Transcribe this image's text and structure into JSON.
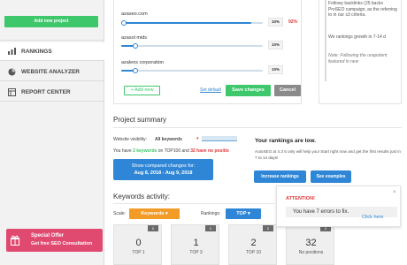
{
  "sidebar": {
    "add_project": "Add new project",
    "nav": [
      {
        "label": "RANKINGS",
        "icon": "rankings-bars-icon"
      },
      {
        "label": "WEBSITE ANALYZER",
        "icon": "pie-chart-icon"
      },
      {
        "label": "REPORT CENTER",
        "icon": "report-grid-icon"
      }
    ],
    "special_offer": {
      "line1": "Special Offer",
      "line2": "Get free SEO Consultation"
    }
  },
  "competitors": {
    "rows": [
      {
        "name": "azaseo.com",
        "pct": "10%",
        "extra": "92%",
        "level": 0.92
      },
      {
        "name": "azasol mids",
        "pct": "10%",
        "extra": "",
        "level": 0.1
      },
      {
        "name": "azaleos corporation",
        "pct": "10%",
        "extra": "",
        "level": 0.1
      }
    ],
    "add_new": "+ Add new",
    "set_default": "Set default",
    "save": "Save changes",
    "cancel": "Cancel"
  },
  "tips": {
    "p1": "Followy backlinks (25 backs ProSEO campaign, as the referring to in our s3 criteria.",
    "p2": "We rankings growth in 7-14 d",
    "p3": "Note: Following the unapotent featured in new"
  },
  "summary": {
    "title": "Project summary",
    "visibility_label": "Website visibility:",
    "visibility_value": "All keywords",
    "keywords_prefix": "You have",
    "keywords_green": "2 keywords",
    "keywords_mid": "on TOP100 and",
    "keywords_red": "32 have no positio",
    "compare_line1": "Show compared changes for:",
    "compare_line2": "Aug 8, 2018 - Aug 9, 2018",
    "low_title": "Your rankings are low.",
    "low_text": "AutoSEO at 4.3 5 only will help you! Start right now and get the first results just in 7 to 14 days!",
    "increase": "Increase rankings",
    "examples": "See examples"
  },
  "activity": {
    "title": "Keywords activity:",
    "scale_label": "Scale:",
    "scale_value": "Keywords",
    "rankings_label": "Rankings:",
    "rankings_value": "TOP",
    "stats": [
      {
        "value": "0",
        "label": "TOP 1",
        "badge": "0"
      },
      {
        "value": "1",
        "label": "TOP 3",
        "badge": "0"
      },
      {
        "value": "2",
        "label": "TOP 10",
        "badge": "2"
      },
      {
        "value": "32",
        "label": "No positions",
        "badge": "0"
      }
    ]
  },
  "popup": {
    "title": "ATTENTION!",
    "message": "You have 7 errors to fix.",
    "link": "Click here",
    "close": "×"
  },
  "colors": {
    "green": "#3ec76b",
    "blue": "#2f86d6",
    "orange": "#f29b26",
    "red": "#e0373a",
    "pink": "#e04a70"
  }
}
